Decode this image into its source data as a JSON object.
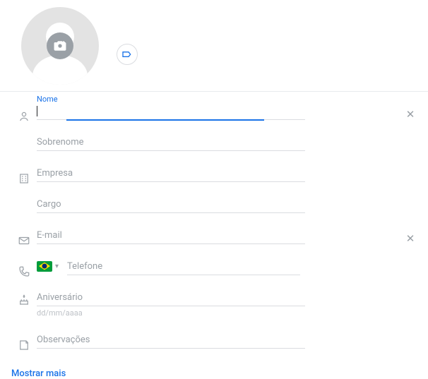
{
  "fields": {
    "first_name_label": "Nome",
    "first_name_value": "",
    "surname_placeholder": "Sobrenome",
    "company_placeholder": "Empresa",
    "job_placeholder": "Cargo",
    "email_placeholder": "E-mail",
    "phone_placeholder": "Telefone",
    "phone_country": "BR",
    "birthday_placeholder": "Aniversário",
    "birthday_hint": "dd/mm/aaaa",
    "notes_placeholder": "Observações"
  },
  "actions": {
    "show_more": "Mostrar mais"
  }
}
